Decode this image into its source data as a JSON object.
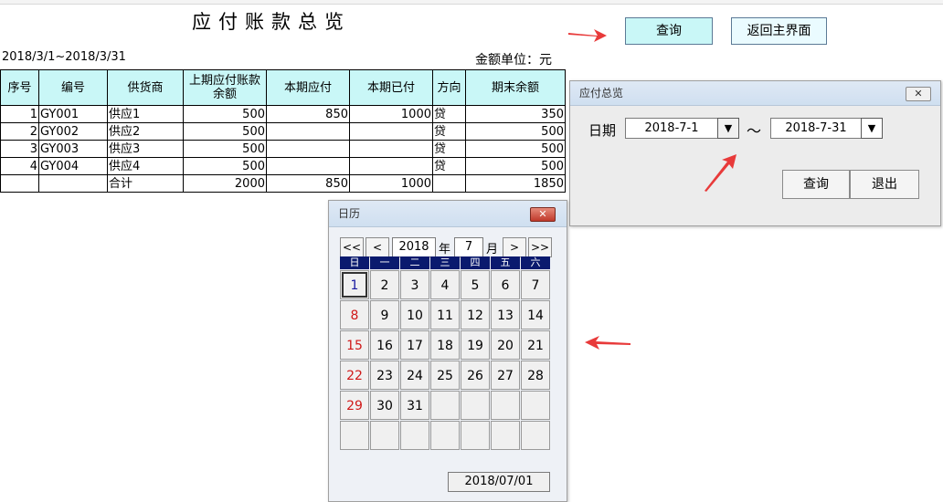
{
  "report": {
    "title": "应付账款总览",
    "period": "2018/3/1~2018/3/31",
    "unit": "金额单位：元",
    "query_btn": "查询",
    "back_btn": "返回主界面"
  },
  "table": {
    "headers": [
      "序号",
      "编号",
      "供货商",
      "上期应付账款余额",
      "本期应付",
      "本期已付",
      "方向",
      "期末余额"
    ],
    "rows": [
      [
        "1",
        "GY001",
        "供应1",
        "500",
        "850",
        "1000",
        "贷",
        "350"
      ],
      [
        "2",
        "GY002",
        "供应2",
        "500",
        "",
        "",
        "贷",
        "500"
      ],
      [
        "3",
        "GY003",
        "供应3",
        "500",
        "",
        "",
        "贷",
        "500"
      ],
      [
        "4",
        "GY004",
        "供应4",
        "500",
        "",
        "",
        "贷",
        "500"
      ]
    ],
    "total": [
      "",
      "",
      "合计",
      "2000",
      "850",
      "1000",
      "",
      "1850"
    ]
  },
  "query_dialog": {
    "title": "应付总览",
    "close": "✕",
    "date_label": "日期",
    "start_date": "2018-7-1",
    "tilde": "～",
    "end_date": "2018-7-31",
    "query_btn": "查询",
    "exit_btn": "退出"
  },
  "calendar": {
    "title": "日历",
    "close": "✕",
    "nav_first": "<<",
    "nav_prev": "<",
    "nav_next": ">",
    "nav_last": ">>",
    "year": "2018",
    "year_unit": "年",
    "month": "7",
    "month_unit": "月",
    "weekdays": [
      "日",
      "一",
      "二",
      "三",
      "四",
      "五",
      "六"
    ],
    "days": [
      "1",
      "2",
      "3",
      "4",
      "5",
      "6",
      "7",
      "8",
      "9",
      "10",
      "11",
      "12",
      "13",
      "14",
      "15",
      "16",
      "17",
      "18",
      "19",
      "20",
      "21",
      "22",
      "23",
      "24",
      "25",
      "26",
      "27",
      "28",
      "29",
      "30",
      "31",
      "",
      "",
      "",
      "",
      "",
      "",
      "",
      "",
      "",
      "",
      ""
    ],
    "selected_day": "1",
    "footer_date": "2018/07/01"
  },
  "colors": {
    "accent_cyan": "#c9f7f7",
    "calendar_header": "#0a1a6e",
    "sunday": "#d01818",
    "arrow": "#e83a3a"
  }
}
